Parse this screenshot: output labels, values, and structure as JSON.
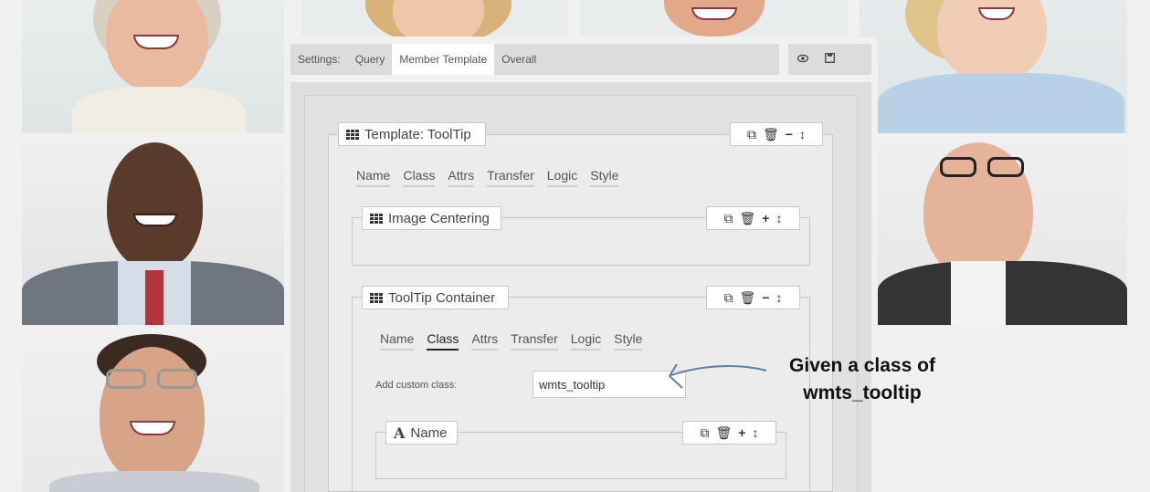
{
  "tabs": {
    "settings_label": "Settings:",
    "query": "Query",
    "member_template": "Member Template",
    "overall": "Overall"
  },
  "toolbar": {
    "preview_icon": "eye-icon",
    "save_icon": "save-icon"
  },
  "template": {
    "title": "Template: ToolTip",
    "subtabs": [
      "Name",
      "Class",
      "Attrs",
      "Transfer",
      "Logic",
      "Style"
    ]
  },
  "image_centering": {
    "title": "Image Centering"
  },
  "tooltip_container": {
    "title": "ToolTip Container",
    "subtabs": [
      "Name",
      "Class",
      "Attrs",
      "Transfer",
      "Logic",
      "Style"
    ],
    "active_subtab": "Class",
    "custom_class_label": "Add custom class:",
    "custom_class_value": "wmts_tooltip"
  },
  "name_block": {
    "title": "Name"
  },
  "annotation": {
    "line1": "Given a class of",
    "line2": "wmts_tooltip"
  },
  "colors": {
    "accent_arrow": "#5f7fa3",
    "tab_bar": "#dcdcdc"
  }
}
